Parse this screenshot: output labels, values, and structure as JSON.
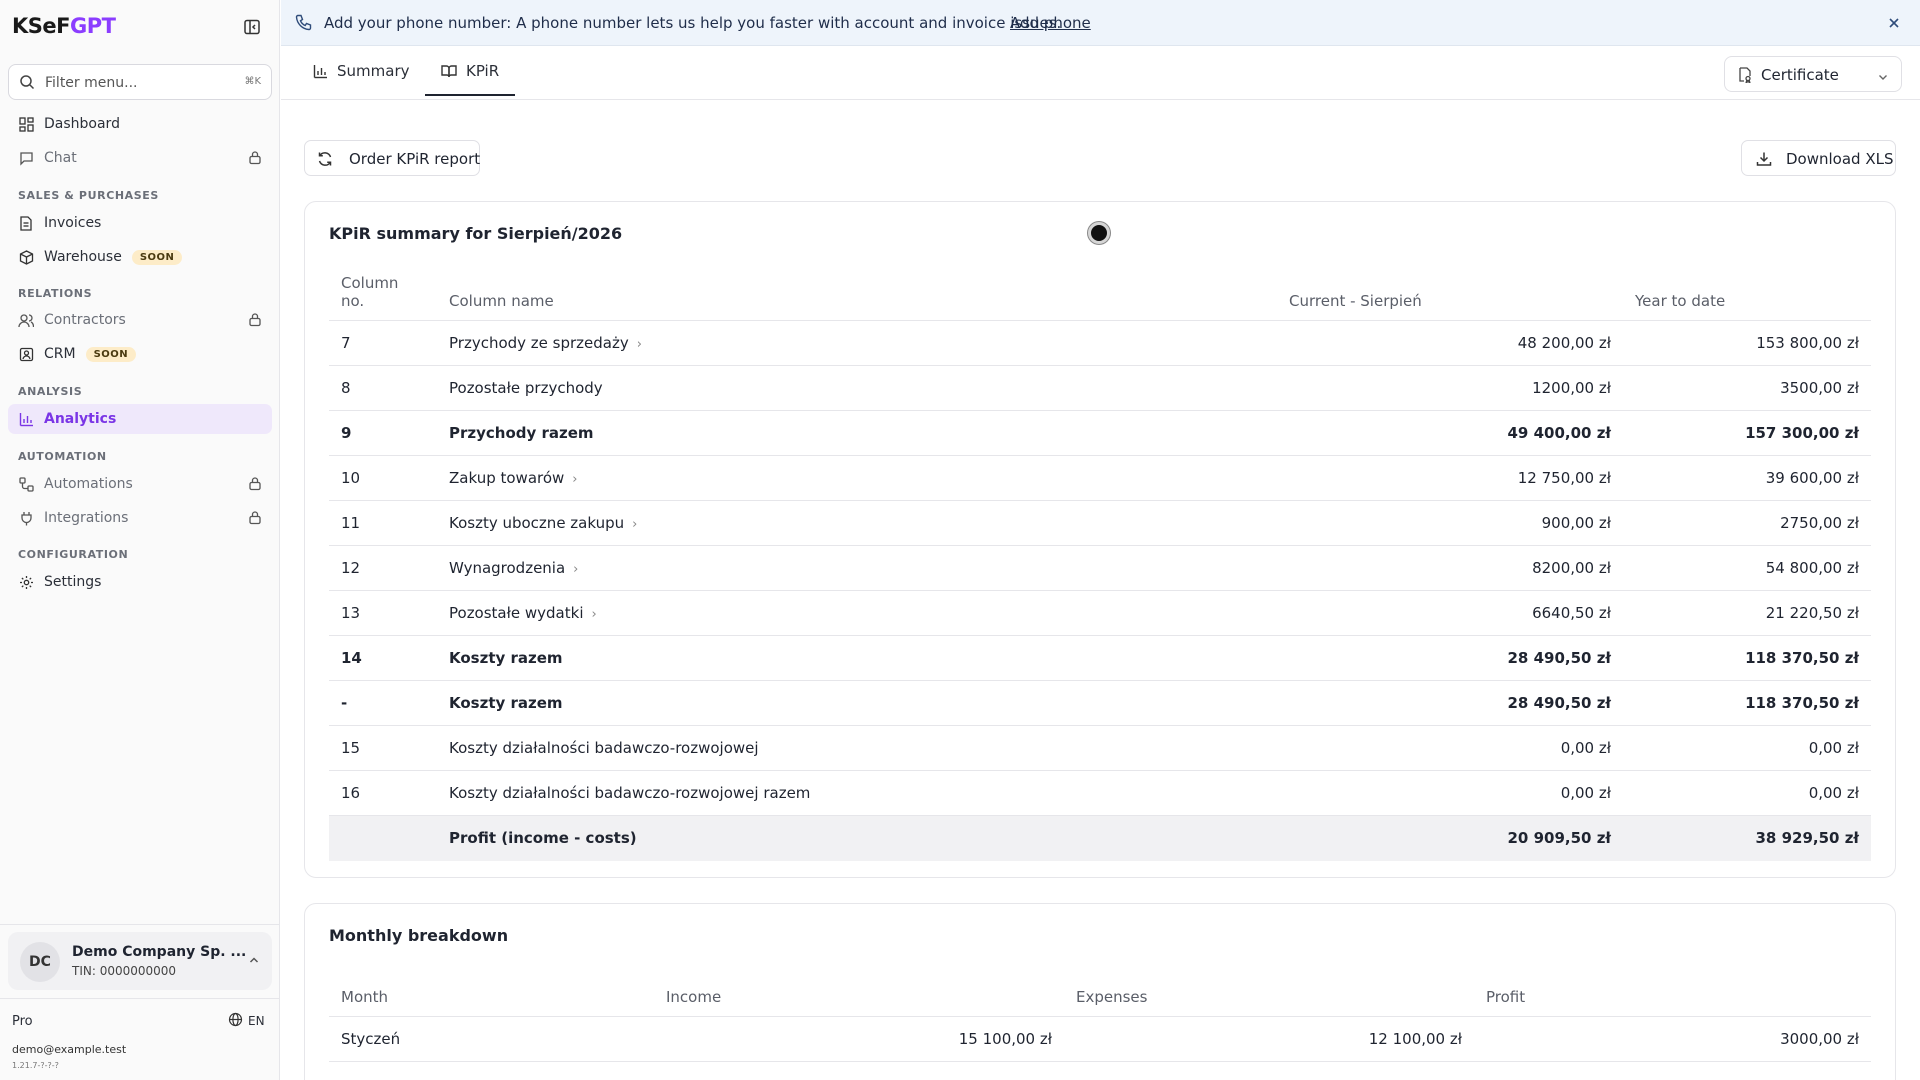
{
  "sidebar": {
    "logo_main": "KSeF",
    "logo_accent": "GPT",
    "filter_placeholder": "Filter menu...",
    "filter_shortcut": "⌘K",
    "items": {
      "dashboard": "Dashboard",
      "chat": "Chat",
      "invoices": "Invoices",
      "warehouse": "Warehouse",
      "contractors": "Contractors",
      "crm": "CRM",
      "analytics": "Analytics",
      "automations": "Automations",
      "integrations": "Integrations",
      "settings": "Settings"
    },
    "soon_badge": "SOON",
    "sections": {
      "sales": "SALES & PURCHASES",
      "relations": "RELATIONS",
      "analysis": "ANALYSIS",
      "automation": "AUTOMATION",
      "configuration": "CONFIGURATION"
    },
    "company": {
      "initials": "DC",
      "name": "Demo Company Sp. ...",
      "tin": "TIN: 0000000000"
    },
    "plan": "Pro",
    "language": "EN",
    "email": "demo@example.test",
    "version": "1.21.7-?-?-?"
  },
  "banner": {
    "text": "Add your phone number: A phone number lets us help you faster with account and invoice issues.",
    "link": "Add phone"
  },
  "tabs": {
    "summary": "Summary",
    "kpir": "KPiR"
  },
  "certificate_label": "Certificate",
  "actions": {
    "order": "Order KPiR report",
    "download": "Download XLS"
  },
  "kpir": {
    "title": "KPiR summary for Sierpień/2026",
    "headers": {
      "col_no_1": "Column",
      "col_no_2": "no.",
      "name": "Column name",
      "current": "Current - Sierpień",
      "ytd": "Year to date"
    },
    "rows": [
      {
        "no": "7",
        "name": "Przychody ze sprzedaży",
        "current": "48 200,00 zł",
        "ytd": "153 800,00 zł"
      },
      {
        "no": "8",
        "name": "Pozostałe przychody",
        "current": "1200,00 zł",
        "ytd": "3500,00 zł"
      },
      {
        "no": "9",
        "name": "Przychody razem",
        "current": "49 400,00 zł",
        "ytd": "157 300,00 zł"
      },
      {
        "no": "10",
        "name": "Zakup towarów",
        "current": "12 750,00 zł",
        "ytd": "39 600,00 zł"
      },
      {
        "no": "11",
        "name": "Koszty uboczne zakupu",
        "current": "900,00 zł",
        "ytd": "2750,00 zł"
      },
      {
        "no": "12",
        "name": "Wynagrodzenia",
        "current": "8200,00 zł",
        "ytd": "54 800,00 zł"
      },
      {
        "no": "13",
        "name": "Pozostałe wydatki",
        "current": "6640,50 zł",
        "ytd": "21 220,50 zł"
      },
      {
        "no": "14",
        "name": "Koszty razem",
        "current": "28 490,50 zł",
        "ytd": "118 370,50 zł"
      },
      {
        "no": "-",
        "name": "Koszty razem",
        "current": "28 490,50 zł",
        "ytd": "118 370,50 zł"
      },
      {
        "no": "15",
        "name": "Koszty działalności badawczo-rozwojowej",
        "current": "0,00 zł",
        "ytd": "0,00 zł"
      },
      {
        "no": "16",
        "name": "Koszty działalności badawczo-rozwojowej razem",
        "current": "0,00 zł",
        "ytd": "0,00 zł"
      },
      {
        "no": "",
        "name": "Profit (income - costs)",
        "current": "20 909,50 zł",
        "ytd": "38 929,50 zł"
      }
    ]
  },
  "monthly": {
    "title": "Monthly breakdown",
    "headers": {
      "month": "Month",
      "income": "Income",
      "expenses": "Expenses",
      "profit": "Profit"
    },
    "rows": [
      {
        "month": "Styczeń",
        "income": "15 100,00 zł",
        "expenses": "12 100,00 zł",
        "profit": "3000,00 zł"
      }
    ]
  }
}
